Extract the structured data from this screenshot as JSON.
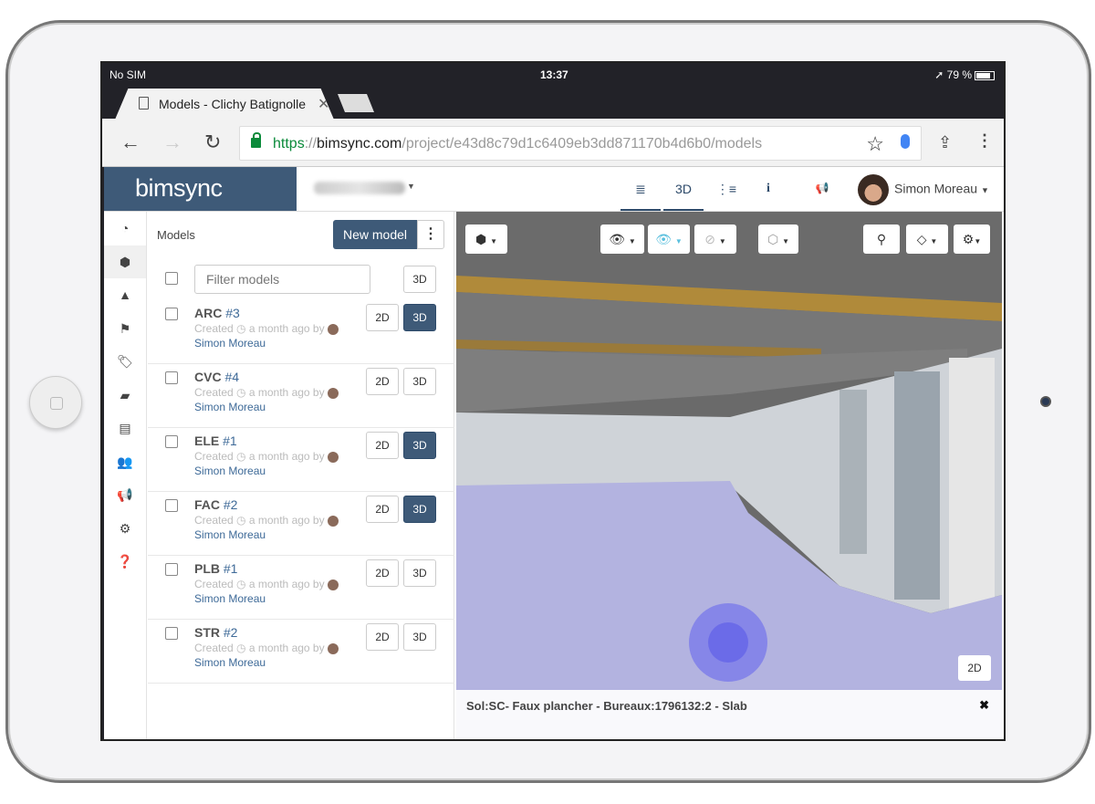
{
  "status": {
    "carrier": "No SIM",
    "time": "13:37",
    "battery": "79 %"
  },
  "browser": {
    "tab_title": "Models - Clichy Batignolle",
    "url_scheme": "https",
    "url_sep": "://",
    "url_domain": "bimsync.com",
    "url_path": "/project/e43d8c79d1c6409eb3dd871170b4d6b0/models"
  },
  "header": {
    "brand": "bimsync",
    "nav": {
      "list": "≣",
      "three_d": "3D",
      "tree": "⋮≡",
      "info": "i",
      "announce": "📢"
    },
    "user": "Simon Moreau"
  },
  "sidebar": {
    "items": [
      "dashboard",
      "models",
      "issues",
      "flags",
      "tags",
      "folders",
      "library",
      "team",
      "announcements",
      "settings",
      "help"
    ]
  },
  "panel": {
    "title": "Models",
    "new_model": "New model",
    "filter_placeholder": "Filter models",
    "three_d_all": "3D",
    "models": [
      {
        "code": "ARC",
        "num": "#3",
        "created": "Created",
        "ago": "a month ago by",
        "author": "Simon Moreau",
        "btn2d": "2D",
        "btn3d": "3D",
        "active3d": true
      },
      {
        "code": "CVC",
        "num": "#4",
        "created": "Created",
        "ago": "a month ago by",
        "author": "Simon Moreau",
        "btn2d": "2D",
        "btn3d": "3D",
        "active3d": false
      },
      {
        "code": "ELE",
        "num": "#1",
        "created": "Created",
        "ago": "a month ago by",
        "author": "Simon Moreau",
        "btn2d": "2D",
        "btn3d": "3D",
        "active3d": true
      },
      {
        "code": "FAC",
        "num": "#2",
        "created": "Created",
        "ago": "a month ago by",
        "author": "Simon Moreau",
        "btn2d": "2D",
        "btn3d": "3D",
        "active3d": true
      },
      {
        "code": "PLB",
        "num": "#1",
        "created": "Created",
        "ago": "a month ago by",
        "author": "Simon Moreau",
        "btn2d": "2D",
        "btn3d": "3D",
        "active3d": false
      },
      {
        "code": "STR",
        "num": "#2",
        "created": "Created",
        "ago": "a month ago by",
        "author": "Simon Moreau",
        "btn2d": "2D",
        "btn3d": "3D",
        "active3d": false
      }
    ]
  },
  "viewer": {
    "toggle_2d": "2D",
    "selection": "Sol:SC- Faux plancher - Bureaux:1796132:2 - Slab",
    "accent": "#3e5a78",
    "floor_color": "#b3b3e0"
  }
}
